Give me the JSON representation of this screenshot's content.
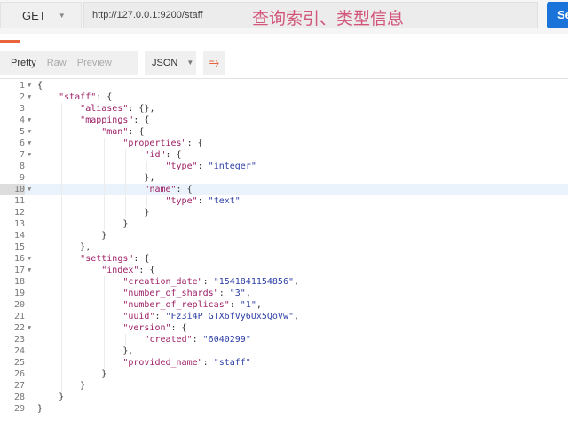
{
  "request": {
    "method": "GET",
    "url": "http://127.0.0.1:9200/staff",
    "annotation": "查询索引、类型信息",
    "send_label": "Se"
  },
  "response_toolbar": {
    "views": [
      "Pretty",
      "Raw",
      "Preview"
    ],
    "active_view": "Pretty",
    "format": "JSON",
    "wrap_icon": "wrap-lines-icon"
  },
  "code": {
    "active_line": 10,
    "lines": [
      {
        "n": "1",
        "f": true,
        "i": 0,
        "t": [
          [
            "p",
            "{"
          ]
        ]
      },
      {
        "n": "2",
        "f": true,
        "i": 1,
        "t": [
          [
            "k",
            "\"staff\""
          ],
          [
            "p",
            ": {"
          ]
        ]
      },
      {
        "n": "3",
        "f": false,
        "i": 2,
        "t": [
          [
            "k",
            "\"aliases\""
          ],
          [
            "p",
            ": {},"
          ]
        ]
      },
      {
        "n": "4",
        "f": true,
        "i": 2,
        "t": [
          [
            "k",
            "\"mappings\""
          ],
          [
            "p",
            ": {"
          ]
        ]
      },
      {
        "n": "5",
        "f": true,
        "i": 3,
        "t": [
          [
            "k",
            "\"man\""
          ],
          [
            "p",
            ": {"
          ]
        ]
      },
      {
        "n": "6",
        "f": true,
        "i": 4,
        "t": [
          [
            "k",
            "\"properties\""
          ],
          [
            "p",
            ": {"
          ]
        ]
      },
      {
        "n": "7",
        "f": true,
        "i": 5,
        "t": [
          [
            "k",
            "\"id\""
          ],
          [
            "p",
            ": {"
          ]
        ]
      },
      {
        "n": "8",
        "f": false,
        "i": 6,
        "t": [
          [
            "k",
            "\"type\""
          ],
          [
            "p",
            ": "
          ],
          [
            "s",
            "\"integer\""
          ]
        ]
      },
      {
        "n": "9",
        "f": false,
        "i": 5,
        "t": [
          [
            "p",
            "},"
          ]
        ]
      },
      {
        "n": "10",
        "f": true,
        "i": 5,
        "t": [
          [
            "k",
            "\"name\""
          ],
          [
            "p",
            ": {"
          ]
        ]
      },
      {
        "n": "11",
        "f": false,
        "i": 6,
        "t": [
          [
            "k",
            "\"type\""
          ],
          [
            "p",
            ": "
          ],
          [
            "s",
            "\"text\""
          ]
        ]
      },
      {
        "n": "12",
        "f": false,
        "i": 5,
        "t": [
          [
            "p",
            "}"
          ]
        ]
      },
      {
        "n": "13",
        "f": false,
        "i": 4,
        "t": [
          [
            "p",
            "}"
          ]
        ]
      },
      {
        "n": "14",
        "f": false,
        "i": 3,
        "t": [
          [
            "p",
            "}"
          ]
        ]
      },
      {
        "n": "15",
        "f": false,
        "i": 2,
        "t": [
          [
            "p",
            "},"
          ]
        ]
      },
      {
        "n": "16",
        "f": true,
        "i": 2,
        "t": [
          [
            "k",
            "\"settings\""
          ],
          [
            "p",
            ": {"
          ]
        ]
      },
      {
        "n": "17",
        "f": true,
        "i": 3,
        "t": [
          [
            "k",
            "\"index\""
          ],
          [
            "p",
            ": {"
          ]
        ]
      },
      {
        "n": "18",
        "f": false,
        "i": 4,
        "t": [
          [
            "k",
            "\"creation_date\""
          ],
          [
            "p",
            ": "
          ],
          [
            "s",
            "\"1541841154856\""
          ],
          [
            "p",
            ","
          ]
        ]
      },
      {
        "n": "19",
        "f": false,
        "i": 4,
        "t": [
          [
            "k",
            "\"number_of_shards\""
          ],
          [
            "p",
            ": "
          ],
          [
            "s",
            "\"3\""
          ],
          [
            "p",
            ","
          ]
        ]
      },
      {
        "n": "20",
        "f": false,
        "i": 4,
        "t": [
          [
            "k",
            "\"number_of_replicas\""
          ],
          [
            "p",
            ": "
          ],
          [
            "s",
            "\"1\""
          ],
          [
            "p",
            ","
          ]
        ]
      },
      {
        "n": "21",
        "f": false,
        "i": 4,
        "t": [
          [
            "k",
            "\"uuid\""
          ],
          [
            "p",
            ": "
          ],
          [
            "s",
            "\"Fz3i4P_GTX6fVy6Ux5QoVw\""
          ],
          [
            "p",
            ","
          ]
        ]
      },
      {
        "n": "22",
        "f": true,
        "i": 4,
        "t": [
          [
            "k",
            "\"version\""
          ],
          [
            "p",
            ": {"
          ]
        ]
      },
      {
        "n": "23",
        "f": false,
        "i": 5,
        "t": [
          [
            "k",
            "\"created\""
          ],
          [
            "p",
            ": "
          ],
          [
            "s",
            "\"6040299\""
          ]
        ]
      },
      {
        "n": "24",
        "f": false,
        "i": 4,
        "t": [
          [
            "p",
            "},"
          ]
        ]
      },
      {
        "n": "25",
        "f": false,
        "i": 4,
        "t": [
          [
            "k",
            "\"provided_name\""
          ],
          [
            "p",
            ": "
          ],
          [
            "s",
            "\"staff\""
          ]
        ]
      },
      {
        "n": "26",
        "f": false,
        "i": 3,
        "t": [
          [
            "p",
            "}"
          ]
        ]
      },
      {
        "n": "27",
        "f": false,
        "i": 2,
        "t": [
          [
            "p",
            "}"
          ]
        ]
      },
      {
        "n": "28",
        "f": false,
        "i": 1,
        "t": [
          [
            "p",
            "}"
          ]
        ]
      },
      {
        "n": "29",
        "f": false,
        "i": 0,
        "t": [
          [
            "p",
            "}"
          ]
        ]
      }
    ]
  }
}
